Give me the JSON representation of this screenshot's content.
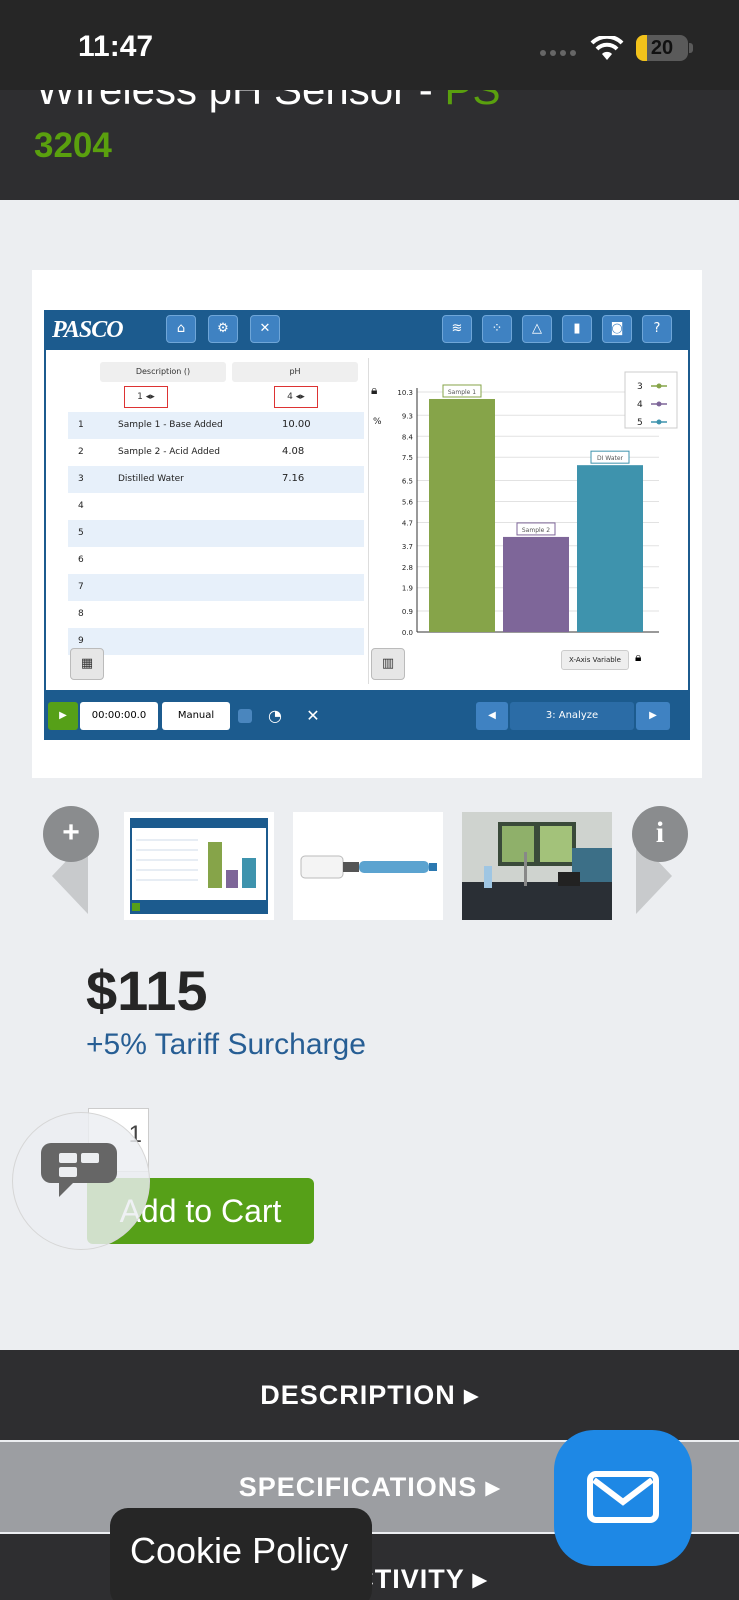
{
  "status_bar": {
    "time": "11:47",
    "battery": "20"
  },
  "product": {
    "title": "Wireless pH Sensor",
    "title_suffix": "PS",
    "code": "3204"
  },
  "software": {
    "logo": "PASCO",
    "table": {
      "headers": [
        "Description ()",
        "pH"
      ],
      "selectors": [
        "1",
        "4"
      ],
      "rows": [
        {
          "n": "1",
          "desc": "Sample 1 - Base Added",
          "ph": "10.00"
        },
        {
          "n": "2",
          "desc": "Sample 2 - Acid Added",
          "ph": "4.08"
        },
        {
          "n": "3",
          "desc": "Distilled Water",
          "ph": "7.16"
        },
        {
          "n": "4",
          "desc": "",
          "ph": ""
        },
        {
          "n": "5",
          "desc": "",
          "ph": ""
        },
        {
          "n": "6",
          "desc": "",
          "ph": ""
        },
        {
          "n": "7",
          "desc": "",
          "ph": ""
        },
        {
          "n": "8",
          "desc": "",
          "ph": ""
        },
        {
          "n": "9",
          "desc": "",
          "ph": ""
        }
      ]
    },
    "x_axis_button": "X-Axis Variable",
    "timer": "00:00:00.0",
    "mode": "Manual",
    "analyze": "3: Analyze",
    "colors": {
      "accent": "#1c5b8e",
      "bar1": "#86a449",
      "bar2": "#7e6699",
      "bar3": "#3e93ad"
    }
  },
  "chart_data": {
    "type": "bar",
    "categories": [
      "Sample 1",
      "Sample 2",
      "DI Water"
    ],
    "values": [
      10.0,
      4.08,
      7.16
    ],
    "ylim": [
      0,
      11
    ],
    "yticks": [
      "10.3",
      "9.3",
      "8.4",
      "7.5",
      "6.5",
      "5.6",
      "4.7",
      "3.7",
      "2.8",
      "1.9",
      "0.9",
      "0.0"
    ],
    "legend": [
      "3",
      "4",
      "5"
    ],
    "legend_placement": "top-right",
    "grid": true
  },
  "price": "$115",
  "surcharge": "+5% Tariff Surcharge",
  "quantity": "1",
  "add_to_cart": "Add to Cart",
  "accordion": {
    "description": "DESCRIPTION",
    "specifications": "SPECIFICATIONS",
    "connectivity": "CONNECTIVITY"
  },
  "cookie": "Cookie Policy",
  "icons": [
    "plus-icon",
    "info-icon",
    "chat-icon",
    "mail-icon",
    "wifi-icon",
    "battery-icon"
  ]
}
